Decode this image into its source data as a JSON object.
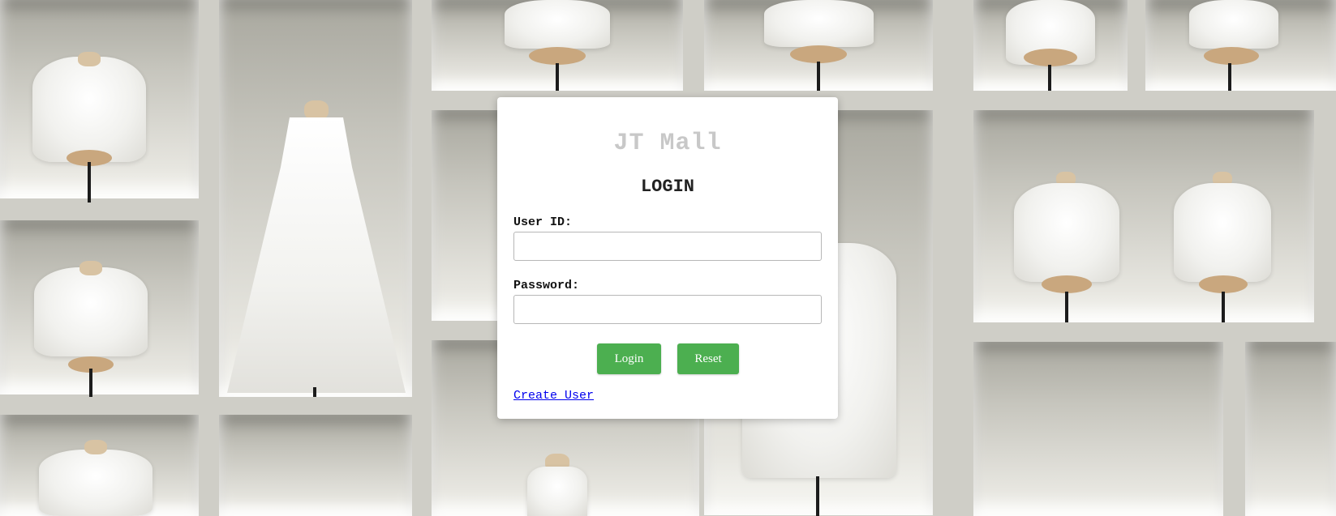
{
  "app": {
    "brand": "JT Mall",
    "heading": "LOGIN"
  },
  "form": {
    "user_id_label": "User ID:",
    "user_id_value": "",
    "password_label": "Password:",
    "password_value": ""
  },
  "buttons": {
    "login": "Login",
    "reset": "Reset",
    "accent_color": "#4caf50"
  },
  "links": {
    "create_user": "Create User"
  },
  "background": {
    "description_icon": "boutique-display-background"
  }
}
